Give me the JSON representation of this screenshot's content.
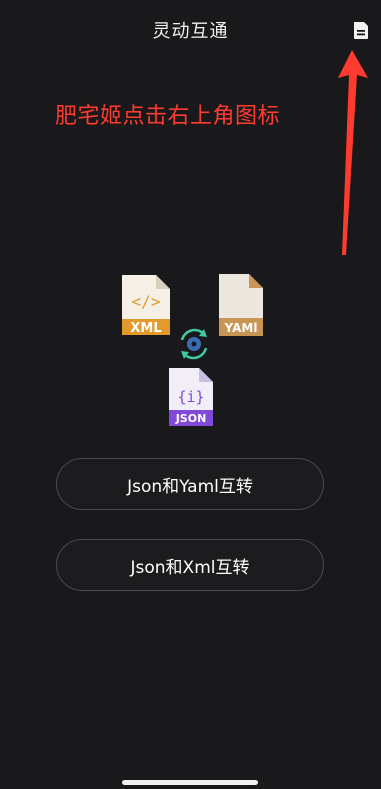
{
  "header": {
    "title": "灵动互通"
  },
  "annotation": {
    "text": "肥宅姬点击右上角图标"
  },
  "icons": {
    "xml_label": "XML",
    "yaml_label": "YAMl",
    "json_label": "JSON",
    "json_glyph": "{i}",
    "xml_glyph": "</>"
  },
  "buttons": {
    "json_yaml": "Json和Yaml互转",
    "json_xml": "Json和Xml互转"
  },
  "colors": {
    "background": "#19181b",
    "annotation": "#ff3b30",
    "xml_badge": "#e39a2c",
    "yaml_badge": "#c89555",
    "json_badge": "#8248d6"
  }
}
